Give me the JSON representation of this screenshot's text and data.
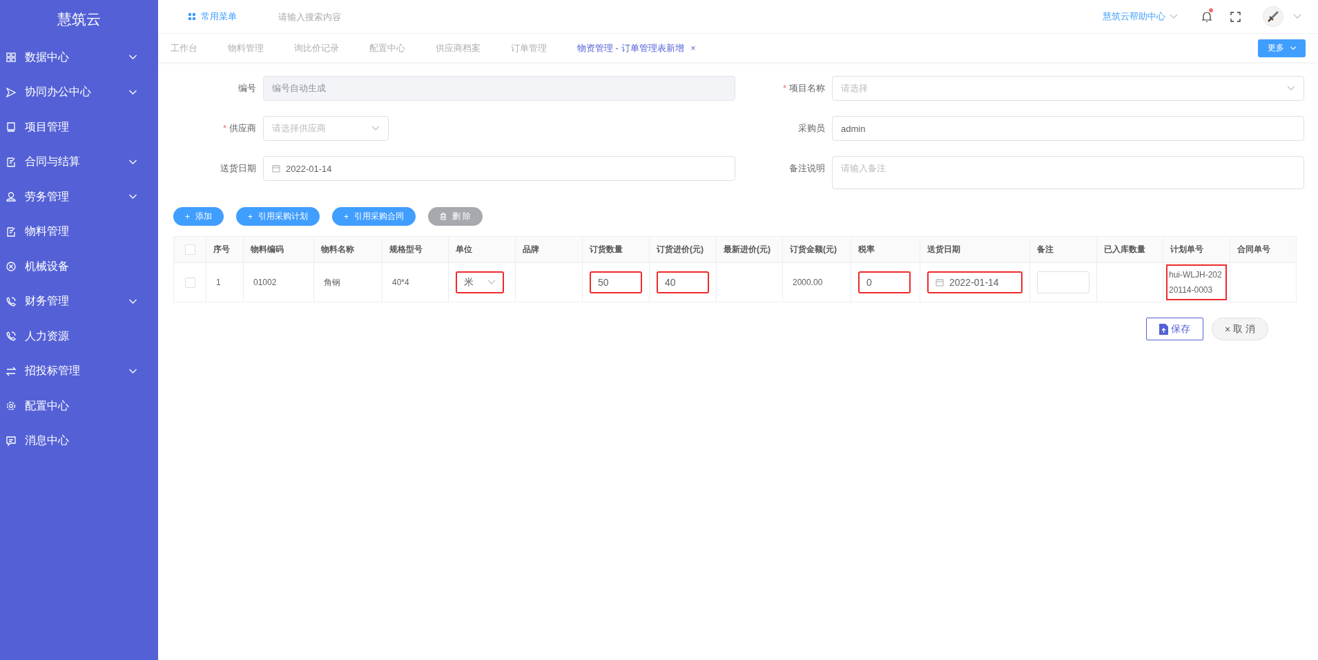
{
  "sidebar": {
    "title": "慧筑云",
    "items": [
      {
        "label": "数据中心",
        "expandable": true
      },
      {
        "label": "协同办公中心",
        "expandable": true
      },
      {
        "label": "项目管理",
        "expandable": false
      },
      {
        "label": "合同与结算",
        "expandable": true
      },
      {
        "label": "劳务管理",
        "expandable": true
      },
      {
        "label": "物料管理",
        "expandable": false
      },
      {
        "label": "机械设备",
        "expandable": false
      },
      {
        "label": "财务管理",
        "expandable": true
      },
      {
        "label": "人力资源",
        "expandable": false
      },
      {
        "label": "招投标管理",
        "expandable": true
      },
      {
        "label": "配置中心",
        "expandable": false
      },
      {
        "label": "消息中心",
        "expandable": false
      }
    ]
  },
  "header": {
    "menu_label": "常用菜单",
    "search": {
      "placeholder": "请输入搜索内容"
    },
    "help_label": "慧筑云帮助中心",
    "notification_unread": true
  },
  "tabs": [
    {
      "label": "工作台",
      "selected": false
    },
    {
      "label": "物料管理",
      "selected": false
    },
    {
      "label": "询比价记录",
      "selected": false
    },
    {
      "label": "配置中心",
      "selected": false
    },
    {
      "label": "供应商档案",
      "selected": false
    },
    {
      "label": "订单管理",
      "selected": false
    },
    {
      "label": "物资管理 - 订单管理表新增",
      "selected": true,
      "close": "×"
    }
  ],
  "more_button": "更多",
  "form": {
    "fields": [
      {
        "label": "编号",
        "kind": "input",
        "placeholder": "编号自动生成",
        "disabled": true,
        "wide": true
      },
      {
        "label": "项目名称",
        "required_mark": "*",
        "kind": "select",
        "placeholder": "请选择",
        "disabled": false,
        "wide": true
      },
      {
        "label": "供应商",
        "required_mark": "*",
        "kind": "select",
        "placeholder": "请选择供应商",
        "disabled": false,
        "wide": false
      },
      {
        "label": "采购员",
        "kind": "input",
        "value": "admin",
        "disabled": false,
        "wide": true
      },
      {
        "label": "送货日期",
        "kind": "date",
        "value": "2022-01-14",
        "disabled": false,
        "wide": true
      },
      {
        "label": "备注说明",
        "kind": "textarea",
        "placeholder": "请输入备注",
        "disabled": false,
        "wide": true
      }
    ]
  },
  "actions": [
    {
      "label": "添加",
      "kind": "primary",
      "symbol": "+"
    },
    {
      "label": "引用采购计划",
      "kind": "primary",
      "symbol": "+"
    },
    {
      "label": "引用采购合同",
      "kind": "primary",
      "symbol": "+"
    },
    {
      "label": "删 除",
      "kind": "disabled"
    }
  ],
  "table": {
    "columns": [
      "序号",
      "物料编码",
      "物料名称",
      "规格型号",
      "单位",
      "品牌",
      "订货数量",
      "订货进价(元)",
      "最新进价(元)",
      "订货金额(元)",
      "税率",
      "送货日期",
      "备注",
      "已入库数量",
      "计划单号",
      "合同单号"
    ],
    "all_checked": false,
    "rows": [
      {
        "checked": false,
        "cells": [
          {
            "kind": "text",
            "text": "1",
            "highlighted": false
          },
          {
            "kind": "text",
            "text": "01002",
            "highlighted": false
          },
          {
            "kind": "text",
            "text": "角钢",
            "highlighted": false
          },
          {
            "kind": "text",
            "text": "40*4",
            "highlighted": false
          },
          {
            "kind": "select",
            "text": "米",
            "highlighted": true
          },
          {
            "kind": "empty"
          },
          {
            "kind": "input",
            "text": "50",
            "highlighted": true
          },
          {
            "kind": "input",
            "text": "40",
            "highlighted": true
          },
          {
            "kind": "empty"
          },
          {
            "kind": "text",
            "text": "2000.00",
            "highlighted": false
          },
          {
            "kind": "input",
            "text": "0",
            "highlighted": true
          },
          {
            "kind": "date",
            "text": "2022-01-14",
            "highlighted": true
          },
          {
            "kind": "blank-input",
            "highlighted": false
          },
          {
            "kind": "empty"
          },
          {
            "kind": "text",
            "text": "hui-WLJH-20220114-0003",
            "highlighted": true
          },
          {
            "kind": "empty"
          }
        ]
      }
    ]
  },
  "footer_buttons": [
    {
      "label": "保存",
      "kind": "save",
      "highlighted": true
    },
    {
      "label": "取 消",
      "kind": "cancel",
      "symbol": "×",
      "highlighted": false
    }
  ]
}
